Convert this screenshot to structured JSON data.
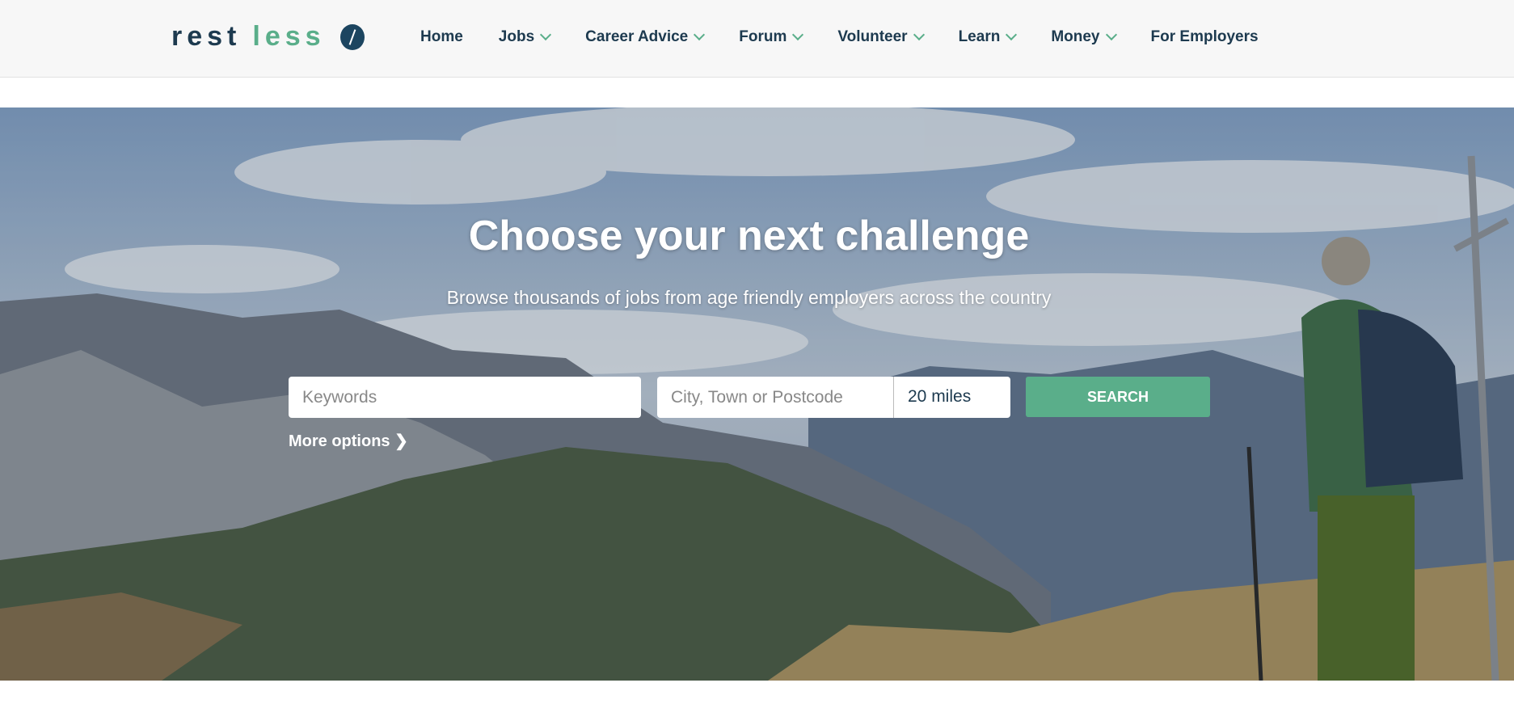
{
  "logo": {
    "word1": "rest",
    "word2": "less"
  },
  "nav": [
    {
      "label": "Home",
      "dropdown": false
    },
    {
      "label": "Jobs",
      "dropdown": true
    },
    {
      "label": "Career Advice",
      "dropdown": true
    },
    {
      "label": "Forum",
      "dropdown": true
    },
    {
      "label": "Volunteer",
      "dropdown": true
    },
    {
      "label": "Learn",
      "dropdown": true
    },
    {
      "label": "Money",
      "dropdown": true
    },
    {
      "label": "For Employers",
      "dropdown": false
    }
  ],
  "hero": {
    "title": "Choose your next challenge",
    "subtitle": "Browse thousands of jobs from age friendly employers across the country"
  },
  "search": {
    "keywords_placeholder": "Keywords",
    "keywords_value": "",
    "location_placeholder": "City, Town or Postcode",
    "location_value": "",
    "radius": "20 miles",
    "button": "SEARCH",
    "more_options": "More options"
  },
  "colors": {
    "brand_dark": "#1d3a4f",
    "accent": "#5aae8a"
  }
}
